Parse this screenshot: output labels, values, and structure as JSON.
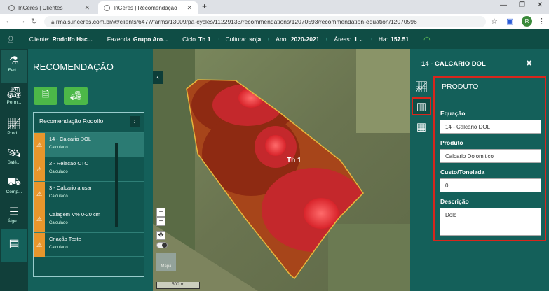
{
  "browser": {
    "tabs": [
      {
        "title": "InCeres | Clientes"
      },
      {
        "title": "InCeres | Recomendação"
      }
    ],
    "new_tab": "+",
    "url": "rmais.inceres.com.br/#!/clients/6477/farms/13009/pa-cycles/11229133/recommendations/12070593/recommendation-equation/12070596",
    "avatar_initial": "R"
  },
  "appbar": {
    "cliente_label": "Cliente:",
    "cliente_value": "Rodolfo Hac...",
    "fazenda_label": "Fazenda",
    "fazenda_value": "Grupo Aro...",
    "ciclo_label": "Ciclo",
    "ciclo_value": "Th 1",
    "cultura_label": "Cultura:",
    "cultura_value": "soja",
    "ano_label": "Ano:",
    "ano_value": "2020-2021",
    "areas_label": "Áreas:",
    "areas_value": "1",
    "ha_label": "Ha:",
    "ha_value": "157.51"
  },
  "rail": [
    {
      "label": "Fert...",
      "icon": "flask-icon"
    },
    {
      "label": "Perm...",
      "icon": "tractor-icon"
    },
    {
      "label": "Prod...",
      "icon": "chart-icon"
    },
    {
      "label": "Saté...",
      "icon": "satellite-icon"
    },
    {
      "label": "Comp...",
      "icon": "compare-icon"
    },
    {
      "label": "Álge...",
      "icon": "layers-icon"
    },
    {
      "label": "",
      "icon": "calculator-icon"
    }
  ],
  "panel": {
    "title": "RECOMENDAÇÃO",
    "list_title": "Recomendação Rodolfo",
    "items": [
      {
        "name": "14 - Calcario DOL",
        "status": "Calculado"
      },
      {
        "name": "2 - Relacao CTC",
        "status": "Calculado"
      },
      {
        "name": "3 - Calcario a usar",
        "status": "Calculado"
      },
      {
        "name": "Calagem V% 0-20 cm",
        "status": "Calculado"
      },
      {
        "name": "Criação Teste",
        "status": "Calculado"
      }
    ]
  },
  "map": {
    "field_label": "Th 1",
    "scale": "500 m",
    "zoom_in": "+",
    "zoom_out": "−",
    "map_label": "Mapa"
  },
  "right": {
    "title": "14 - CALCARIO DOL",
    "section": "PRODUTO",
    "equacao_label": "Equação",
    "equacao_value": "14 - Calcario DOL",
    "produto_label": "Produto",
    "produto_value": "Calcario Dolomitico",
    "custo_label": "Custo/Tonelada",
    "custo_value": "0",
    "descricao_label": "Descrição",
    "descricao_value": "Dolc"
  },
  "colors": {
    "accent": "#14605a",
    "highlight": "#d9261c",
    "button": "#4cb848",
    "warning": "#e8962c"
  }
}
